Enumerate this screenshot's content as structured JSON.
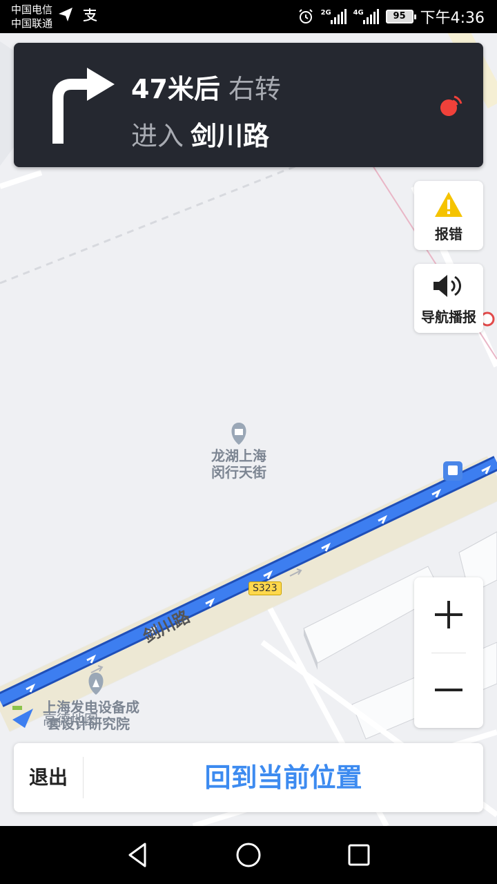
{
  "status_bar": {
    "carrier1": "中国电信",
    "carrier2": "中国联通",
    "sig1_tag": "2G",
    "sig2_tag": "4G",
    "battery": "95",
    "time": "下午4:36"
  },
  "nav": {
    "distance": "47米后",
    "action": "右转",
    "enter_label": "进入",
    "road": "剑川路"
  },
  "side": {
    "report_label": "报错",
    "voice_label": "导航播报"
  },
  "map": {
    "poi1_line1": "龙湖上海",
    "poi1_line2": "闵行天街",
    "road_label": "剑川路",
    "shield": "S323",
    "poi2_line1": "上海发电设备成",
    "poi2_line2": "套设计研究院",
    "watermark": "高德地图"
  },
  "bottom": {
    "exit_label": "退出",
    "recenter_label": "回到当前位置"
  },
  "colors": {
    "route_blue": "#3d7ef0",
    "banner_bg": "#252830",
    "accent_blue": "#3d8bf0",
    "warning_yellow": "#f5c300",
    "gps_red": "#f0413a"
  }
}
